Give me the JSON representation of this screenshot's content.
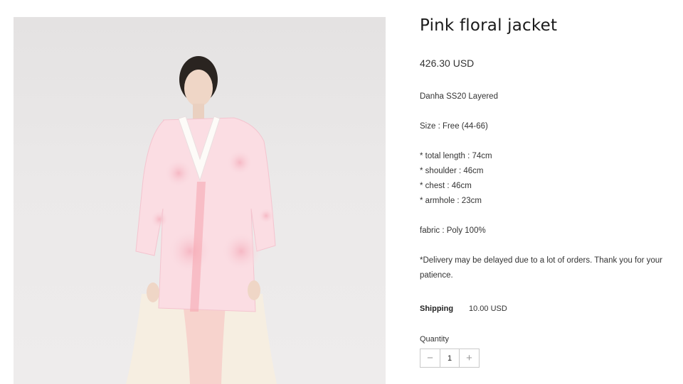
{
  "product": {
    "title": "Pink floral jacket",
    "price": "426.30 USD",
    "description": {
      "collection": "Danha SS20 Layered",
      "size": "Size : Free (44-66)",
      "measurements": [
        "* total length : 74cm",
        "* shoulder : 46cm",
        "* chest : 46cm",
        "* armhole : 23cm"
      ],
      "fabric": "fabric : Poly 100%",
      "delivery_note": "*Delivery may be delayed due to a lot of orders. Thank you for your patience."
    },
    "shipping": {
      "label": "Shipping",
      "value": "10.00 USD"
    },
    "quantity": {
      "label": "Quantity",
      "value": "1",
      "decrease": "−",
      "increase": "+"
    }
  },
  "icons": {
    "decrease": "minus-icon",
    "increase": "plus-icon"
  },
  "colors": {
    "accent_pink": "#f08aa0",
    "background": "#ebe9e9",
    "text": "#222222"
  }
}
